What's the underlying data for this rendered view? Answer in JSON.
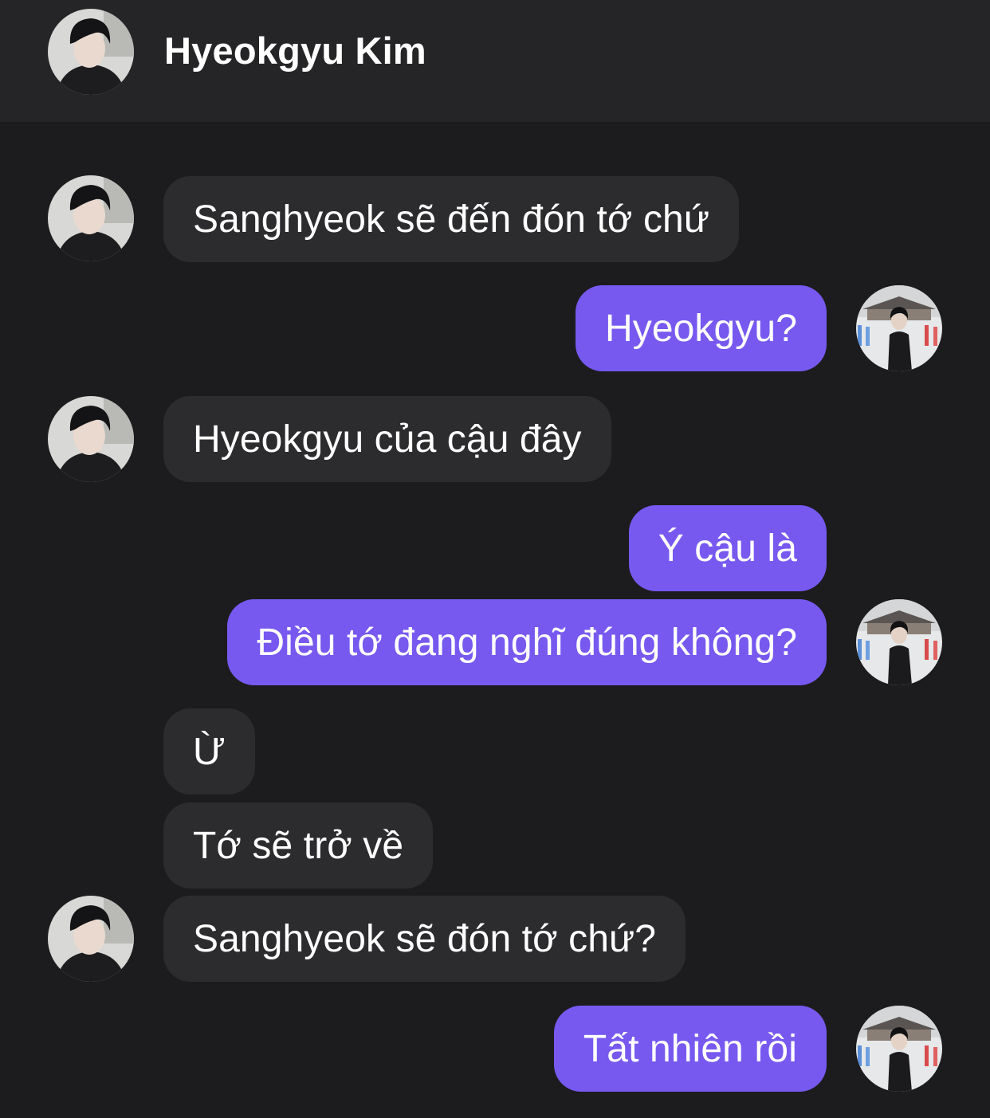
{
  "chat": {
    "contact_name": "Hyeokgyu Kim"
  },
  "messages": [
    {
      "sender": "contact",
      "text": "Sanghyeok sẽ đến đón tớ chứ"
    },
    {
      "sender": "me",
      "text": "Hyeokgyu?"
    },
    {
      "sender": "contact",
      "text": "Hyeokgyu của cậu đây"
    },
    {
      "sender": "me",
      "text": "Ý cậu là"
    },
    {
      "sender": "me",
      "text": "Điều tớ đang nghĩ đúng không?"
    },
    {
      "sender": "contact",
      "text": "Ừ"
    },
    {
      "sender": "contact",
      "text": "Tớ sẽ trở về"
    },
    {
      "sender": "contact",
      "text": "Sanghyeok sẽ đón tớ chứ?"
    },
    {
      "sender": "me",
      "text": "Tất nhiên rồi"
    }
  ],
  "icons": {
    "contact_avatar": "person-in-black-avatar",
    "my_avatar": "person-at-palace-avatar"
  },
  "colors": {
    "background": "#1c1c1e",
    "header": "#252527",
    "incoming_bubble": "#2c2c2e",
    "outgoing_bubble": "#7759f0",
    "text": "#ffffff"
  }
}
